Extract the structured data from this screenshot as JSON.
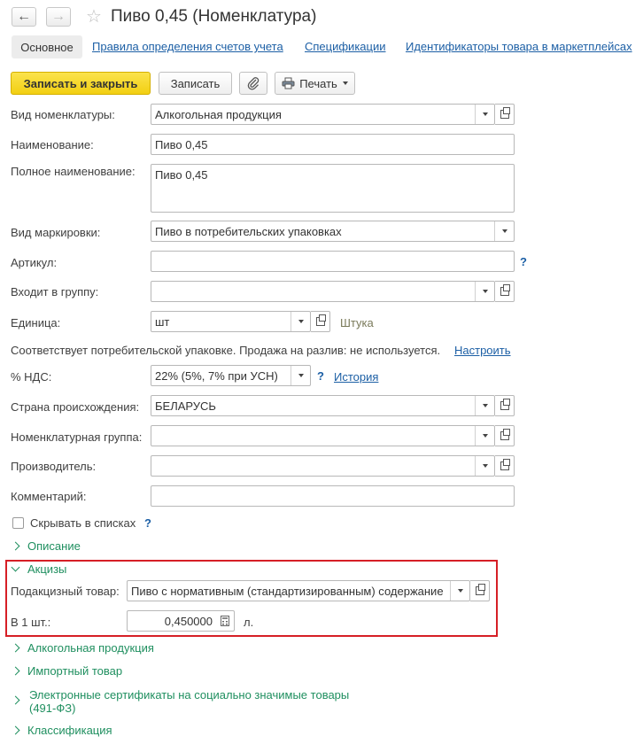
{
  "window": {
    "title": "Пиво 0,45 (Номенклатура)"
  },
  "nav": {
    "back": "←",
    "forward": "→",
    "star": "☆"
  },
  "tabs": [
    {
      "label": "Основное"
    },
    {
      "label": "Правила определения счетов учета"
    },
    {
      "label": "Спецификации"
    },
    {
      "label": "Идентификаторы товара в маркетплейсах"
    }
  ],
  "toolbar": {
    "save_close": "Записать и закрыть",
    "save": "Записать",
    "print": "Печать"
  },
  "form": {
    "vid_nomenklatury": {
      "label": "Вид номенклатуры:",
      "value": "Алкогольная продукция"
    },
    "naimenovanie": {
      "label": "Наименование:",
      "value": "Пиво 0,45"
    },
    "polnoe": {
      "label": "Полное наименование:",
      "value": "Пиво 0,45"
    },
    "markirovka": {
      "label": "Вид маркировки:",
      "value": "Пиво в потребительских упаковках"
    },
    "artikul": {
      "label": "Артикул:",
      "value": ""
    },
    "gruppa": {
      "label": "Входит в группу:",
      "value": ""
    },
    "edinica": {
      "label": "Единица:",
      "value": "шт",
      "hint": "Штука"
    },
    "upakovka": {
      "text": "Соответствует потребительской упаковке. Продажа на разлив: не используется.",
      "link": "Настроить"
    },
    "nds": {
      "label": "% НДС:",
      "value": "22% (5%, 7% при УСН)",
      "link": "История"
    },
    "strana": {
      "label": "Страна происхождения:",
      "value": "БЕЛАРУСЬ"
    },
    "nom_gruppa": {
      "label": "Номенклатурная группа:",
      "value": ""
    },
    "proizvoditel": {
      "label": "Производитель:",
      "value": ""
    },
    "kommentariy": {
      "label": "Комментарий:",
      "value": ""
    },
    "skryvat": {
      "label": "Скрывать в списках",
      "checked": false
    },
    "help": "?"
  },
  "groups": {
    "opisanie": "Описание",
    "akcizy": {
      "title": "Акцизы",
      "podakciz_label": "Подакцизный товар:",
      "podakciz_value": "Пиво с нормативным (стандартизированным) содержание",
      "v1sht_label": "В 1 шт.:",
      "v1sht_value": "0,450000",
      "v1sht_unit": "л."
    },
    "alko": "Алкогольная продукция",
    "import": "Импортный товар",
    "sertifikaty": "Электронные сертификаты на социально значимые товары",
    "sertifikaty_line2": "(491-ФЗ)",
    "klassifikaciya": "Классификация"
  },
  "colors": {
    "accent": "#f2cf12",
    "link": "#1c5fa5",
    "group": "#1f8f5f",
    "highlight": "#d61f26"
  }
}
